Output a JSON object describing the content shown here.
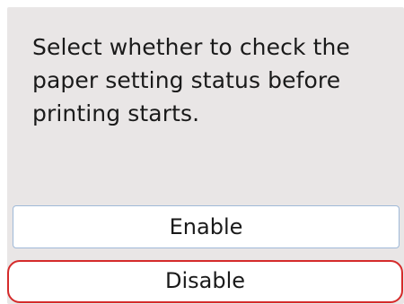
{
  "dialog": {
    "message": "Select whether to check the paper setting status before printing starts.",
    "options": [
      {
        "label": "Enable"
      },
      {
        "label": "Disable"
      }
    ],
    "highlight_color": "#d52b2b"
  }
}
